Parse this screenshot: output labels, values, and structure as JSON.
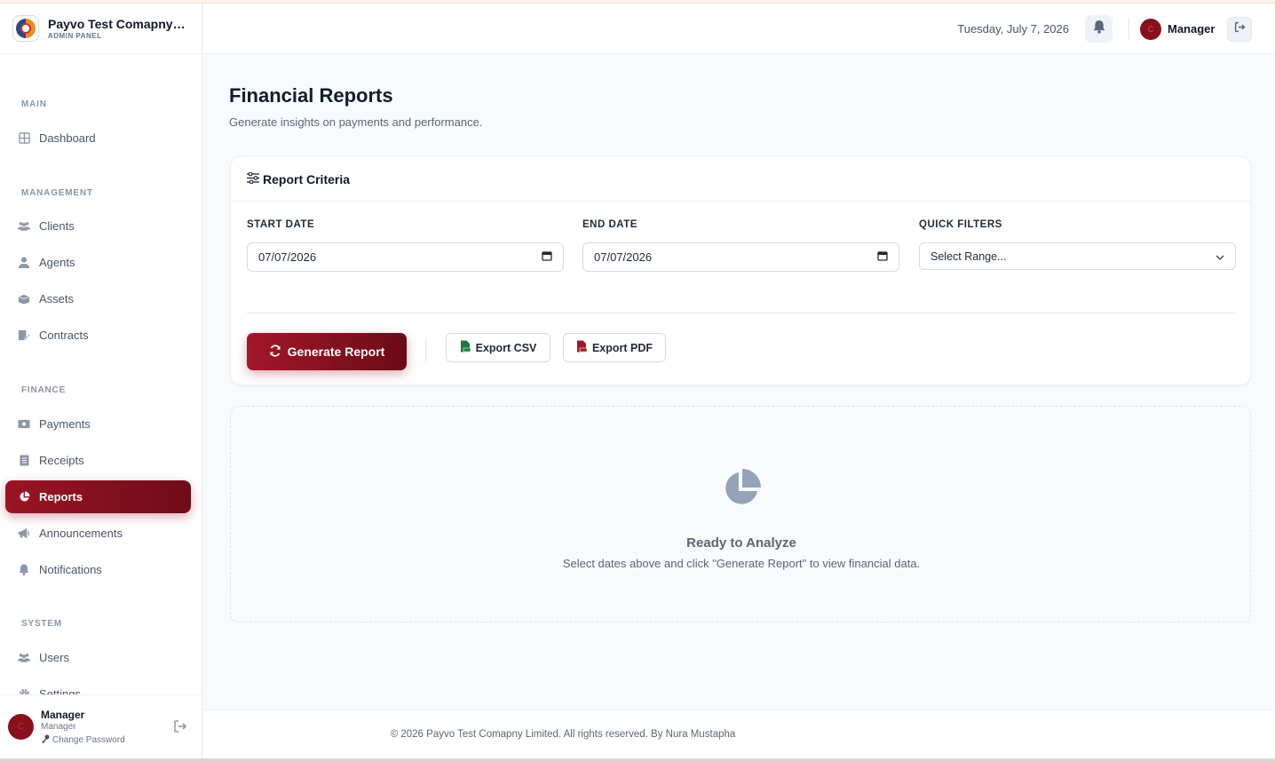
{
  "brand": {
    "name": "Payvo Test Comapny Limited",
    "subtitle": "ADMIN PANEL"
  },
  "header": {
    "date": "Tuesday, July 7, 2026",
    "user_initial": "C",
    "user_name": "Manager"
  },
  "sidebar": {
    "sections": [
      {
        "title": "MAIN",
        "items": [
          {
            "label": "Dashboard",
            "icon": "grid-icon"
          }
        ]
      },
      {
        "title": "MANAGEMENT",
        "items": [
          {
            "label": "Clients",
            "icon": "users-icon"
          },
          {
            "label": "Agents",
            "icon": "user-icon"
          },
          {
            "label": "Assets",
            "icon": "box-icon"
          },
          {
            "label": "Contracts",
            "icon": "contract-icon"
          }
        ]
      },
      {
        "title": "FINANCE",
        "items": [
          {
            "label": "Payments",
            "icon": "money-icon"
          },
          {
            "label": "Receipts",
            "icon": "receipt-icon"
          },
          {
            "label": "Reports",
            "icon": "pie-chart-icon",
            "active": true
          },
          {
            "label": "Announcements",
            "icon": "megaphone-icon"
          },
          {
            "label": "Notifications",
            "icon": "bell-icon"
          }
        ]
      },
      {
        "title": "SYSTEM",
        "items": [
          {
            "label": "Users",
            "icon": "users-icon"
          },
          {
            "label": "Settings",
            "icon": "gear-icon"
          }
        ]
      }
    ],
    "footer": {
      "initial": "C",
      "name": "Manager",
      "role": "Manager",
      "change_password": "Change Password"
    }
  },
  "page": {
    "title": "Financial Reports",
    "subtitle": "Generate insights on payments and performance."
  },
  "criteria": {
    "title": "Report Criteria",
    "start_label": "START DATE",
    "start_value": "07/07/2026",
    "end_label": "END DATE",
    "end_value": "07/07/2026",
    "filters_label": "QUICK FILTERS",
    "filters_value": "Select Range...",
    "generate_label": "Generate Report",
    "csv_label": "Export CSV",
    "pdf_label": "Export PDF"
  },
  "empty_state": {
    "title": "Ready to Analyze",
    "message": "Select dates above and click \"Generate Report\" to view financial data."
  },
  "footer": {
    "text": "© 2026 Payvo Test Comapny Limited. All rights reserved. By Nura Mustapha"
  },
  "colors": {
    "accent": "#9b1424",
    "accent_dark": "#6e0c17",
    "muted": "#64748b"
  }
}
